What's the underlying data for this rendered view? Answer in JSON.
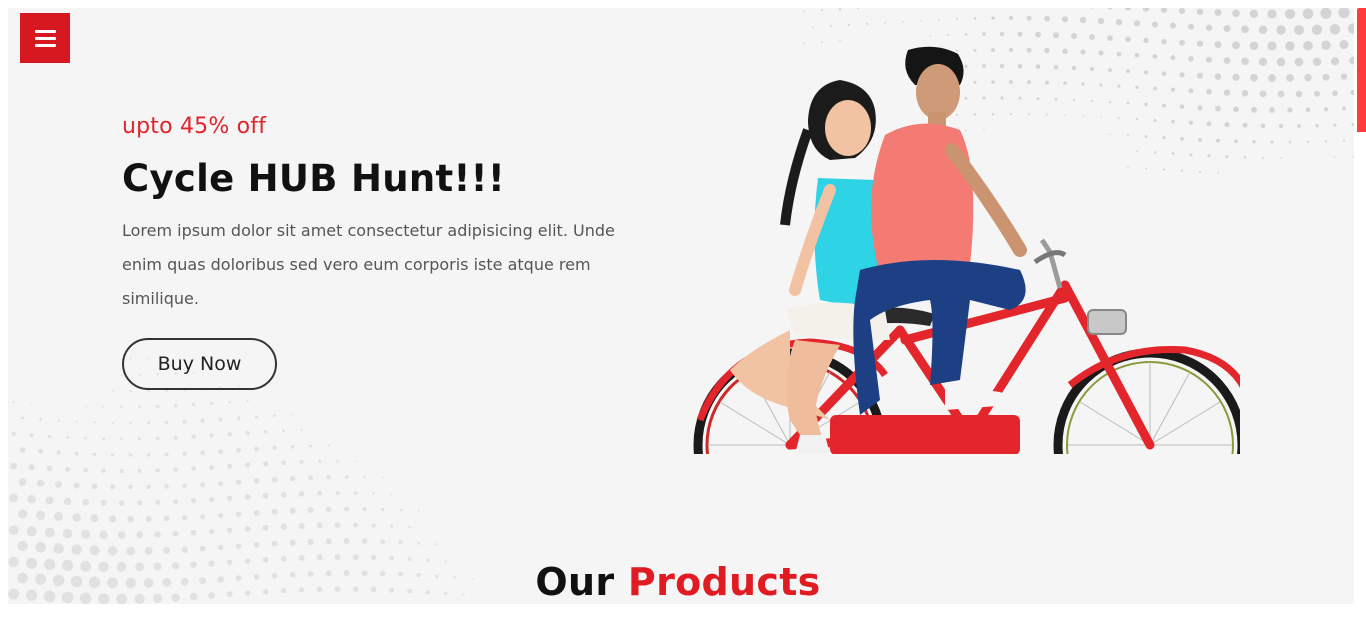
{
  "menu": {
    "icon": "hamburger-menu-icon"
  },
  "hero": {
    "discount": "upto 45% off",
    "title": "Cycle HUB Hunt!!!",
    "description": "Lorem ipsum dolor sit amet consectetur adipisicing elit. Unde enim quas doloribus sed vero eum corporis iste atque rem similique.",
    "cta_label": "Buy Now",
    "image": "couple-riding-red-bicycle"
  },
  "products": {
    "heading_part1": "Our",
    "heading_part2": "Products"
  },
  "colors": {
    "accent": "#e0242c",
    "menu_bg": "#d71820",
    "heading": "#111111",
    "body_text": "#555555"
  }
}
